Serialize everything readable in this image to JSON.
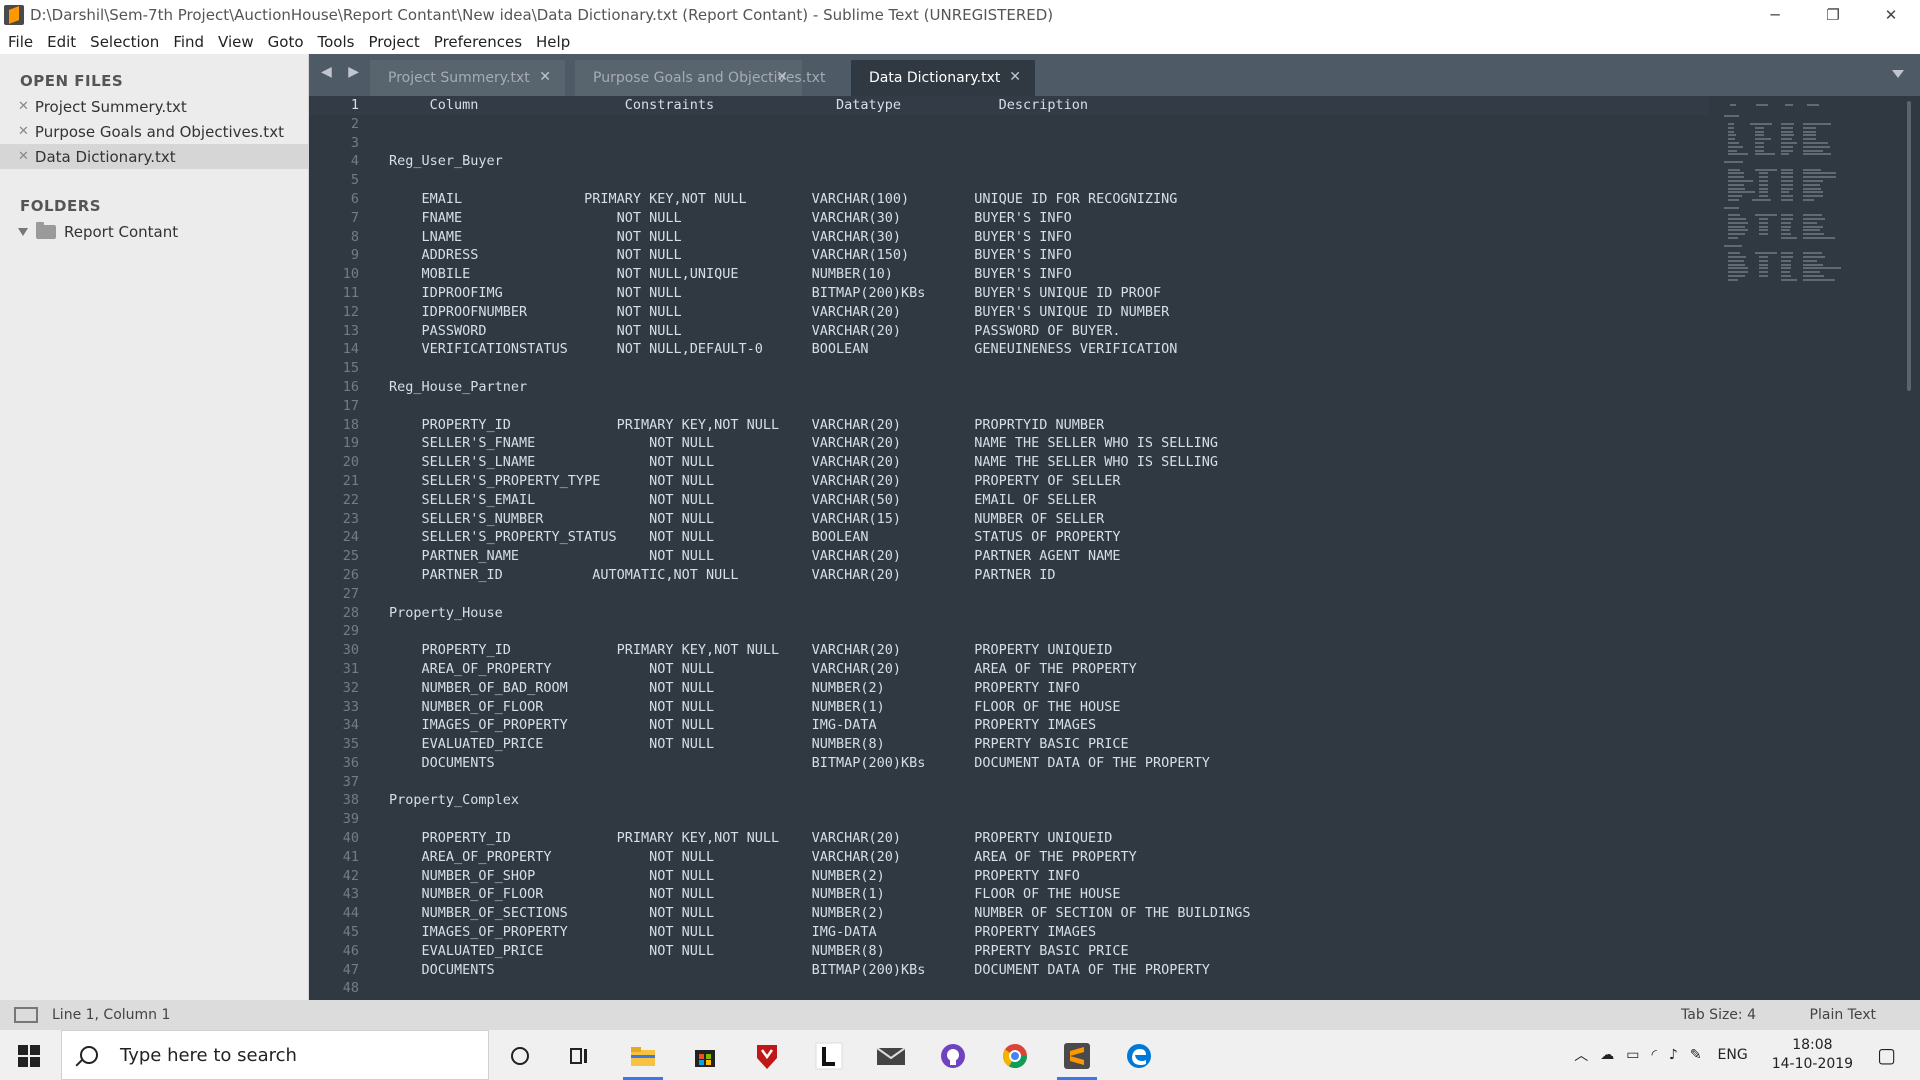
{
  "window": {
    "title": "D:\\Darshil\\Sem-7th Project\\AuctionHouse\\Report Contant\\New idea\\Data Dictionary.txt (Report Contant) - Sublime Text (UNREGISTERED)",
    "min_glyph": "─",
    "max_glyph": "❐",
    "close_glyph": "✕"
  },
  "menu": [
    "File",
    "Edit",
    "Selection",
    "Find",
    "View",
    "Goto",
    "Tools",
    "Project",
    "Preferences",
    "Help"
  ],
  "sidebar": {
    "open_files_header": "OPEN FILES",
    "files": [
      "Project Summery.txt",
      "Purpose Goals and Objectives.txt",
      "Data Dictionary.txt"
    ],
    "folders_header": "FOLDERS",
    "folder": "Report Contant"
  },
  "tabs": [
    {
      "label": "Project Summery.txt",
      "active": false
    },
    {
      "label": "Purpose Goals and Objectives.txt",
      "active": false
    },
    {
      "label": "Data Dictionary.txt",
      "active": true
    }
  ],
  "tab_close_glyph": "✕",
  "tab_arrows": "◀ ▶",
  "editor": {
    "lines": [
      "     Column                  Constraints               Datatype            Description",
      "",
      "",
      "Reg_User_Buyer",
      "",
      "    EMAIL               PRIMARY KEY,NOT NULL        VARCHAR(100)        UNIQUE ID FOR RECOGNIZING",
      "    FNAME                   NOT NULL                VARCHAR(30)         BUYER'S INFO",
      "    LNAME                   NOT NULL                VARCHAR(30)         BUYER'S INFO",
      "    ADDRESS                 NOT NULL                VARCHAR(150)        BUYER'S INFO",
      "    MOBILE                  NOT NULL,UNIQUE         NUMBER(10)          BUYER'S INFO",
      "    IDPROOFIMG              NOT NULL                BITMAP(200)KBs      BUYER'S UNIQUE ID PROOF",
      "    IDPROOFNUMBER           NOT NULL                VARCHAR(20)         BUYER'S UNIQUE ID NUMBER",
      "    PASSWORD                NOT NULL                VARCHAR(20)         PASSWORD OF BUYER.",
      "    VERIFICATIONSTATUS      NOT NULL,DEFAULT-0      BOOLEAN             GENEUINENESS VERIFICATION",
      "",
      "Reg_House_Partner",
      "",
      "    PROPERTY_ID             PRIMARY KEY,NOT NULL    VARCHAR(20)         PROPRTYID NUMBER",
      "    SELLER'S_FNAME              NOT NULL            VARCHAR(20)         NAME THE SELLER WHO IS SELLING",
      "    SELLER'S_LNAME              NOT NULL            VARCHAR(20)         NAME THE SELLER WHO IS SELLING",
      "    SELLER'S_PROPERTY_TYPE      NOT NULL            VARCHAR(20)         PROPERTY OF SELLER",
      "    SELLER'S_EMAIL              NOT NULL            VARCHAR(50)         EMAIL OF SELLER",
      "    SELLER'S_NUMBER             NOT NULL            VARCHAR(15)         NUMBER OF SELLER",
      "    SELLER'S_PROPERTY_STATUS    NOT NULL            BOOLEAN             STATUS OF PROPERTY",
      "    PARTNER_NAME                NOT NULL            VARCHAR(20)         PARTNER AGENT NAME",
      "    PARTNER_ID           AUTOMATIC,NOT NULL         VARCHAR(20)         PARTNER ID",
      "",
      "Property_House",
      "",
      "    PROPERTY_ID             PRIMARY KEY,NOT NULL    VARCHAR(20)         PROPERTY UNIQUEID",
      "    AREA_OF_PROPERTY            NOT NULL            VARCHAR(20)         AREA OF THE PROPERTY",
      "    NUMBER_OF_BAD_ROOM          NOT NULL            NUMBER(2)           PROPERTY INFO",
      "    NUMBER_OF_FLOOR             NOT NULL            NUMBER(1)           FLOOR OF THE HOUSE",
      "    IMAGES_OF_PROPERTY          NOT NULL            IMG-DATA            PROPERTY IMAGES",
      "    EVALUATED_PRICE             NOT NULL            NUMBER(8)           PRPERTY BASIC PRICE",
      "    DOCUMENTS                                       BITMAP(200)KBs      DOCUMENT DATA OF THE PROPERTY",
      "",
      "Property_Complex",
      "",
      "    PROPERTY_ID             PRIMARY KEY,NOT NULL    VARCHAR(20)         PROPERTY UNIQUEID",
      "    AREA_OF_PROPERTY            NOT NULL            VARCHAR(20)         AREA OF THE PROPERTY",
      "    NUMBER_OF_SHOP              NOT NULL            NUMBER(2)           PROPERTY INFO",
      "    NUMBER_OF_FLOOR             NOT NULL            NUMBER(1)           FLOOR OF THE HOUSE",
      "    NUMBER_OF_SECTIONS          NOT NULL            NUMBER(2)           NUMBER OF SECTION OF THE BUILDINGS",
      "    IMAGES_OF_PROPERTY          NOT NULL            IMG-DATA            PROPERTY IMAGES",
      "    EVALUATED_PRICE             NOT NULL            NUMBER(8)           PRPERTY BASIC PRICE",
      "    DOCUMENTS                                       BITMAP(200)KBs      DOCUMENT DATA OF THE PROPERTY",
      ""
    ]
  },
  "status": {
    "position": "Line 1, Column 1",
    "tab_size": "Tab Size: 4",
    "syntax": "Plain Text"
  },
  "taskbar": {
    "search_placeholder": "Type here to search",
    "icons": [
      "cortana-circle",
      "task-view",
      "file-explorer",
      "microsoft-store",
      "mcafee",
      "l-app",
      "mail",
      "github",
      "chrome",
      "sublime-text",
      "edge"
    ],
    "tray_lang": "ENG",
    "time": "18:08",
    "date": "14-10-2019"
  },
  "colors": {
    "editor_bg": "#303841",
    "tabbar_bg": "#4e5a65",
    "text": "#d8dee9",
    "sidebar_bg": "#ececec",
    "accent": "#3b78e7"
  }
}
